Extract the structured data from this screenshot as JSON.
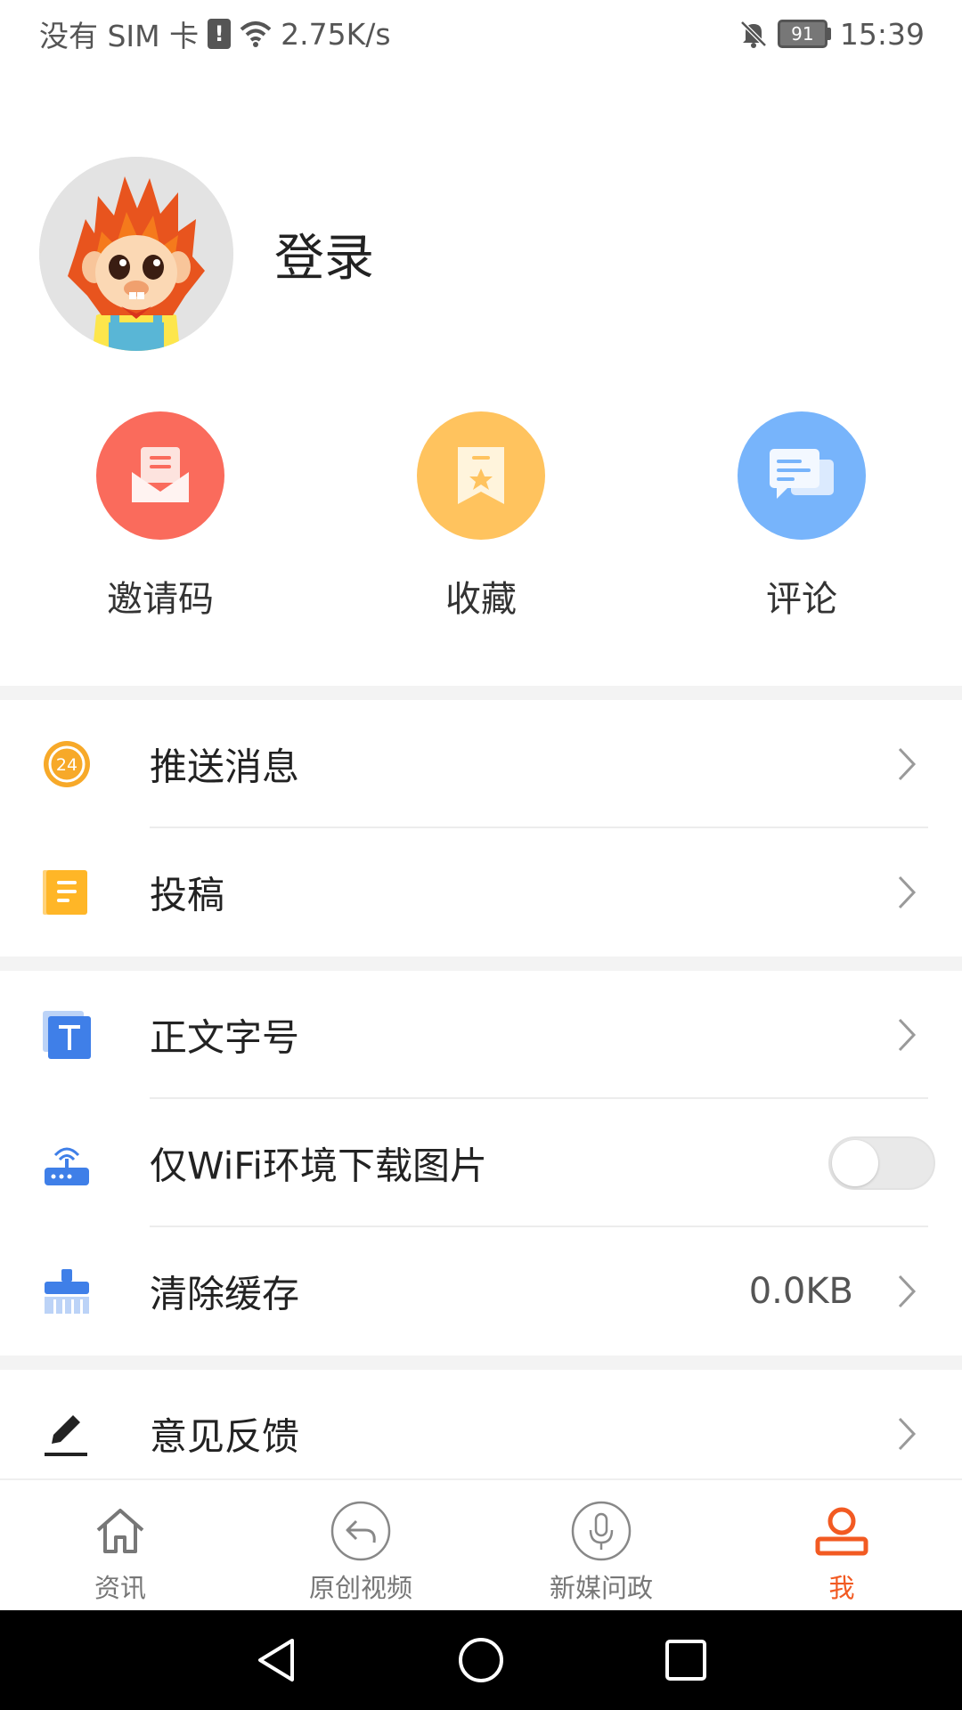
{
  "status_bar": {
    "carrier": "没有 SIM 卡",
    "alert": "!",
    "speed": "2.75K/s",
    "battery": "91",
    "time": "15:39"
  },
  "profile": {
    "login_label": "登录"
  },
  "quick_actions": [
    {
      "label": "邀请码",
      "icon": "invite-envelope-icon",
      "color": "#fa6b5c"
    },
    {
      "label": "收藏",
      "icon": "bookmark-star-icon",
      "color": "#ffc35e"
    },
    {
      "label": "评论",
      "icon": "comment-bubbles-icon",
      "color": "#77b4fb"
    }
  ],
  "menu": {
    "push": "推送消息",
    "submit": "投稿",
    "font_size": "正文字号",
    "wifi_images": "仅WiFi环境下载图片",
    "clear_cache": "清除缓存",
    "cache_size": "0.0KB",
    "feedback": "意见反馈"
  },
  "settings": {
    "wifi_only_images_enabled": false
  },
  "bottom_nav": [
    {
      "label": "资讯",
      "icon": "home-icon"
    },
    {
      "label": "原创视频",
      "icon": "share-arrow-icon"
    },
    {
      "label": "新媒问政",
      "icon": "microphone-icon"
    },
    {
      "label": "我",
      "icon": "profile-icon",
      "active": true
    }
  ],
  "colors": {
    "accent": "#f25a22",
    "push_icon": "#f7a929",
    "submit_icon": "#ffb627",
    "font_icon": "#3f7fe8",
    "wifi_icon": "#3f7fe8",
    "cache_icon": "#3f7fe8"
  }
}
